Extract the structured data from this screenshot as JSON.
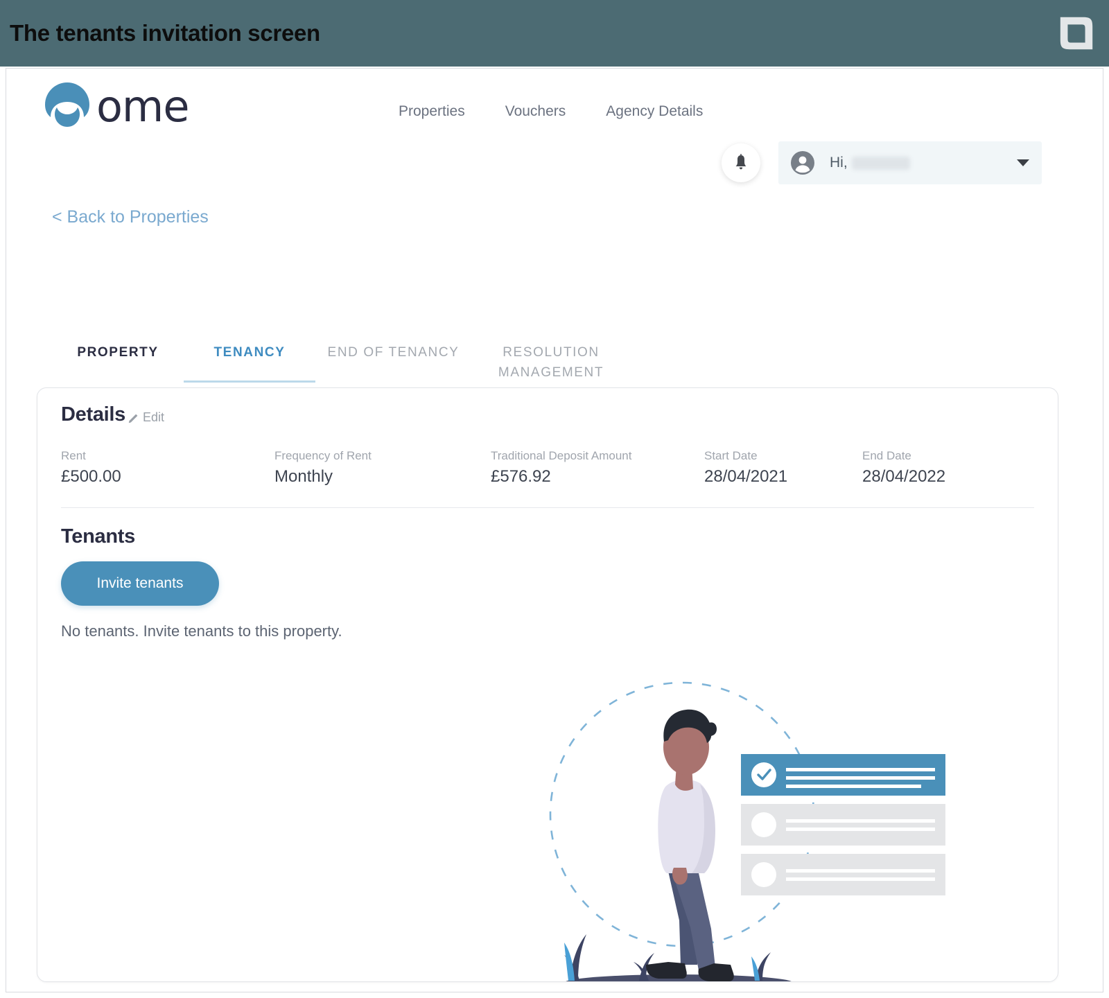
{
  "banner": {
    "title": "The tenants invitation screen",
    "brand_icon": "leaf-logo-icon",
    "bg_color": "#4c6b73"
  },
  "header": {
    "logo_text": "ome",
    "logo_icon": "ome-circle-logo-icon",
    "nav": [
      {
        "label": "Properties"
      },
      {
        "label": "Vouchers"
      },
      {
        "label": "Agency Details"
      }
    ],
    "notifications_icon": "bell-icon",
    "user_menu": {
      "avatar_icon": "user-avatar-icon",
      "greeting": "Hi,",
      "name": "",
      "caret_icon": "chevron-down-icon"
    }
  },
  "back_link": {
    "label": "< Back to Properties"
  },
  "tabs": [
    {
      "label": "PROPERTY",
      "state": "inactive-dark"
    },
    {
      "label": "TENANCY",
      "state": "active"
    },
    {
      "label": "END OF TENANCY",
      "state": "inactive"
    },
    {
      "label": "RESOLUTION MANAGEMENT",
      "state": "inactive"
    }
  ],
  "card": {
    "details": {
      "title": "Details",
      "edit_label": "Edit",
      "edit_icon": "pencil-icon",
      "fields": [
        {
          "label": "Rent",
          "value": "£500.00"
        },
        {
          "label": "Frequency of Rent",
          "value": "Monthly"
        },
        {
          "label": "Traditional Deposit Amount",
          "value": "£576.92"
        },
        {
          "label": "Start Date",
          "value": "28/04/2021"
        },
        {
          "label": "End Date",
          "value": "28/04/2022"
        }
      ]
    },
    "tenants": {
      "title": "Tenants",
      "invite_button_label": "Invite tenants",
      "empty_message": "No tenants. Invite tenants to this property."
    },
    "illustration": {
      "name": "empty-state-person-checklist-illustration",
      "accent_color": "#4a90b9",
      "rows": [
        {
          "state": "checked",
          "color": "#4a90b9"
        },
        {
          "state": "unchecked",
          "color": "#e4e5e7"
        },
        {
          "state": "unchecked",
          "color": "#e4e5e7"
        }
      ]
    }
  },
  "colors": {
    "accent": "#4a90b9",
    "banner": "#4c6b73",
    "link": "#7aa9cf",
    "text_dark": "#2b2d42",
    "text_muted": "#a0a5ad"
  }
}
